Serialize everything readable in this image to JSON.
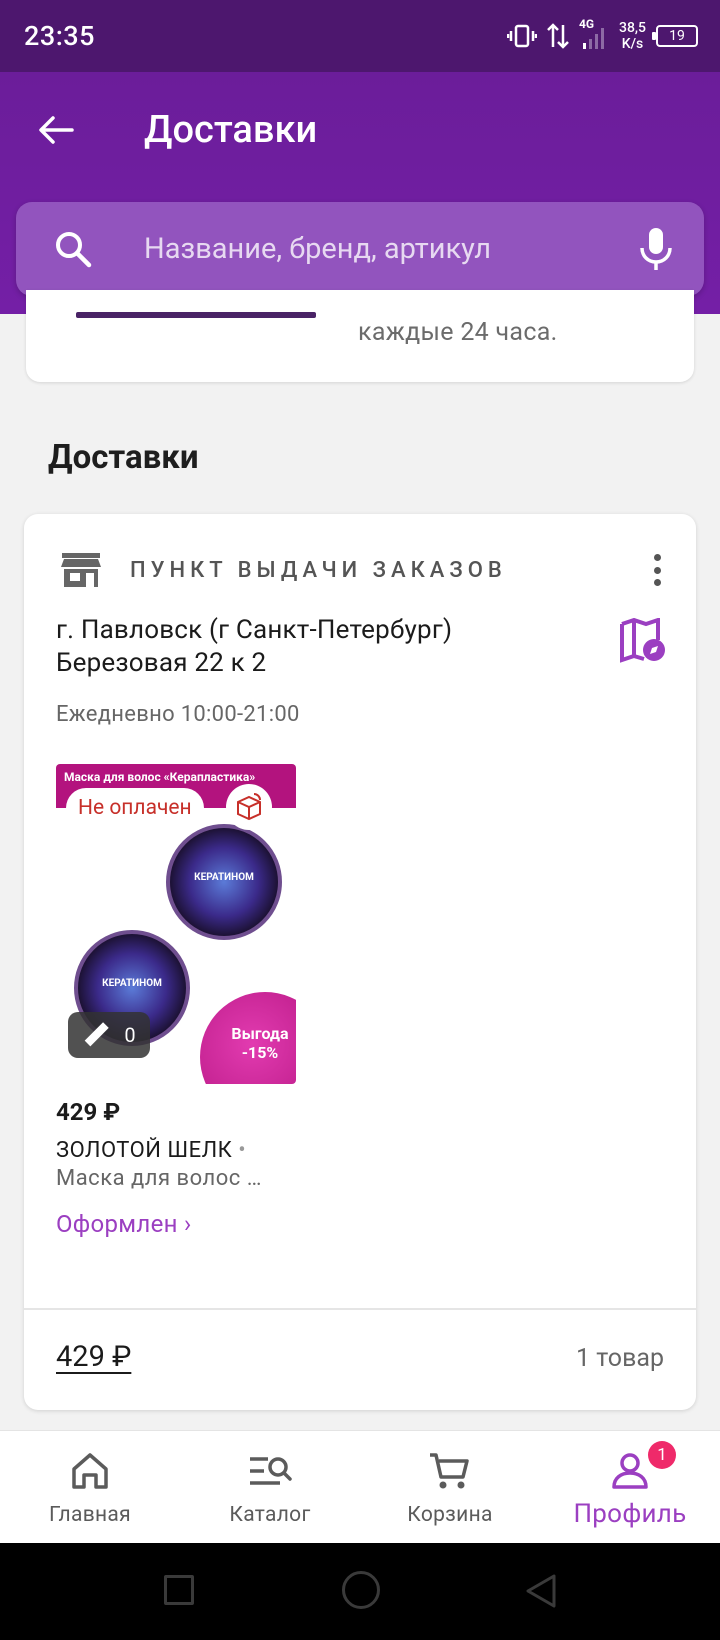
{
  "status_bar": {
    "time": "23:35",
    "net_speed_value": "38,5",
    "net_speed_unit": "K/s",
    "network_type": "4G",
    "battery": "19"
  },
  "header": {
    "title": "Доставки",
    "search_placeholder": "Название, бренд, артикул"
  },
  "previous_card": {
    "text": "каждые 24 часа."
  },
  "section_title": "Доставки",
  "delivery": {
    "type_label": "ПУНКТ ВЫДАЧИ ЗАКАЗОВ",
    "address_line1": "г. Павловск (г Санкт-Петербург)",
    "address_line2": "Березовая 22 к 2",
    "hours": "Ежедневно 10:00-21:00",
    "product": {
      "image_banner": "Маска для волос «Керапластика»",
      "jar_label": "КЕРАТИНОМ",
      "promo": "Выгода -15%",
      "payment_badge": "Не оплачен",
      "measure_count": "0",
      "price": "429 ₽",
      "brand": "ЗОЛОТОЙ ШЕЛК",
      "name": "Маска для волос …",
      "status": "Оформлен ›"
    },
    "total": "429 ₽",
    "items_count": "1 товар"
  },
  "bottom_nav": {
    "items": [
      {
        "label": "Главная",
        "icon": "home-icon"
      },
      {
        "label": "Каталог",
        "icon": "catalog-icon"
      },
      {
        "label": "Корзина",
        "icon": "cart-icon"
      },
      {
        "label": "Профиль",
        "icon": "profile-icon",
        "badge": "1",
        "active": true
      }
    ]
  },
  "colors": {
    "brand_purple": "#741fa6",
    "accent_text": "#9b3fc1",
    "unpaid_red": "#c7302a",
    "badge_pink": "#ef2a6a"
  }
}
